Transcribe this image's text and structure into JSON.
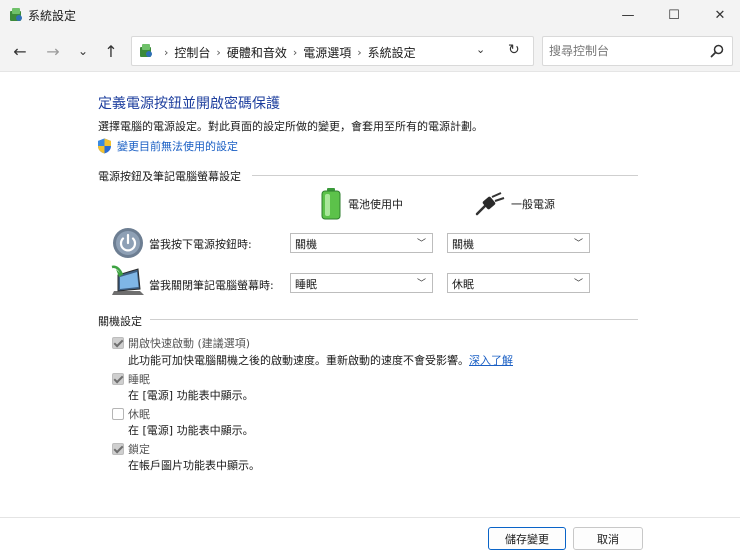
{
  "window": {
    "title": "系統設定",
    "minimize_glyph": "—",
    "maximize_glyph": "☐",
    "close_glyph": "✕"
  },
  "nav": {
    "back_glyph": "←",
    "forward_glyph": "→",
    "recent_glyph": "⌄",
    "up_glyph": "↑"
  },
  "breadcrumb": {
    "items": [
      "控制台",
      "硬體和音效",
      "電源選項",
      "系統設定"
    ],
    "separator": "›",
    "dropdown_glyph": "⌄",
    "refresh_glyph": "↻"
  },
  "search": {
    "placeholder": "搜尋控制台"
  },
  "page": {
    "title": "定義電源按鈕並開啟密碼保護",
    "description": "選擇電腦的電源設定。對此頁面的設定所做的變更，會套用至所有的電源計劃。",
    "change_link": "變更目前無法使用的設定"
  },
  "power_section": {
    "title": "電源按鈕及筆記電腦螢幕設定",
    "col_battery": "電池使用中",
    "col_plugged": "一般電源",
    "rows": [
      {
        "label": "當我按下電源按鈕時:",
        "battery_value": "關機",
        "plugged_value": "關機"
      },
      {
        "label": "當我關閉筆記電腦螢幕時:",
        "battery_value": "睡眠",
        "plugged_value": "休眠"
      }
    ]
  },
  "shutdown_section": {
    "title": "關機設定",
    "items": [
      {
        "label": "開啟快速啟動 (建議選項)",
        "description": "此功能可加快電腦關機之後的啟動速度。重新啟動的速度不會受影響。",
        "link": "深入了解",
        "checked": true
      },
      {
        "label": "睡眠",
        "description": "在 [電源] 功能表中顯示。",
        "checked": true
      },
      {
        "label": "休眠",
        "description": "在 [電源] 功能表中顯示。",
        "checked": false
      },
      {
        "label": "鎖定",
        "description": "在帳戶圖片功能表中顯示。",
        "checked": true
      }
    ]
  },
  "footer": {
    "save_label": "儲存變更",
    "cancel_label": "取消"
  },
  "colors": {
    "title_blue": "#1e3f9e",
    "link_blue": "#1a5fc4",
    "chrome_bg": "#f3f3f3",
    "primary_border": "#0a64c8"
  }
}
